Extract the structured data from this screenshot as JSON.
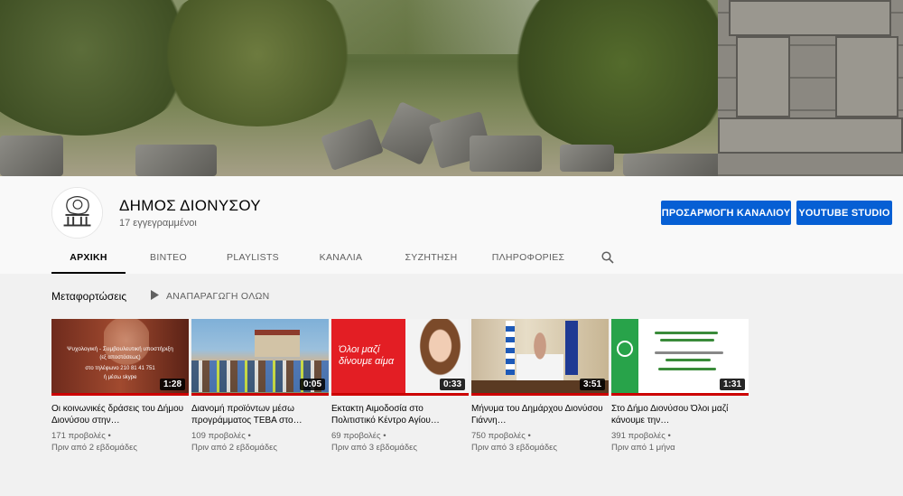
{
  "channel": {
    "name": "ΔΗΜΟΣ ΔΙΟΝΥΣΟΥ",
    "subscribers": "17 εγγεγραμμένοι",
    "avatar_caption": "Δήμος Διονύσου"
  },
  "actions": {
    "customize": "ΠΡΟΣΑΡΜΟΓΗ ΚΑΝΑΛΙΟΥ",
    "studio": "YOUTUBE STUDIO"
  },
  "tabs": [
    {
      "label": "ΑΡΧΙΚΗ",
      "active": true
    },
    {
      "label": "ΒΙΝΤΕΟ",
      "active": false
    },
    {
      "label": "PLAYLISTS",
      "active": false
    },
    {
      "label": "ΚΑΝΑΛΙΑ",
      "active": false
    },
    {
      "label": "ΣΥΖΗΤΗΣΗ",
      "active": false
    },
    {
      "label": "ΠΛΗΡΟΦΟΡΙΕΣ",
      "active": false
    }
  ],
  "section": {
    "title": "Μεταφορτώσεις",
    "play_all": "ΑΝΑΠΑΡΑΓΩΓΗ ΟΛΩΝ"
  },
  "videos": [
    {
      "title": "Οι κοινωνικές δράσεις του Δήμου Διονύσου στην…",
      "views": "171 προβολές",
      "age": "Πριν από 2 εβδομάδες",
      "duration": "1:28",
      "thumb_text": [
        "Ψυχολογική - Συμβουλευτική υποστήριξη",
        "(εξ αποστάσεως)",
        "στο τηλέφωνο 210 81 41 751",
        "ή μέσω skype"
      ]
    },
    {
      "title": "Διανομή προϊόντων μέσω προγράμματος ΤΕΒΑ στο…",
      "views": "109 προβολές",
      "age": "Πριν από 2 εβδομάδες",
      "duration": "0:05"
    },
    {
      "title": "Εκτακτη Αιμοδοσία στο Πολιτιστικό Κέντρο Αγίου…",
      "views": "69 προβολές",
      "age": "Πριν από 3 εβδομάδες",
      "duration": "0:33",
      "thumb_text": [
        "Όλοι μαζί",
        "δίνουμε αίμα"
      ]
    },
    {
      "title": "Μήνυμα του Δημάρχου Διονύσου Γιάννη…",
      "views": "750 προβολές",
      "age": "Πριν από 3 εβδομάδες",
      "duration": "3:51"
    },
    {
      "title": "Στο Δήμο Διονύσου Όλοι μαζί κάνουμε την…",
      "views": "391 προβολές",
      "age": "Πριν από 1 μήνα",
      "duration": "1:31"
    }
  ],
  "meta_separator": "•",
  "colors": {
    "accent": "#065fd4",
    "progress": "#cc0000",
    "page_bg": "#f1f1f1",
    "header_bg": "#f9f9f9"
  },
  "icons": {
    "tab_search": "search-icon",
    "play_all": "play-icon"
  }
}
